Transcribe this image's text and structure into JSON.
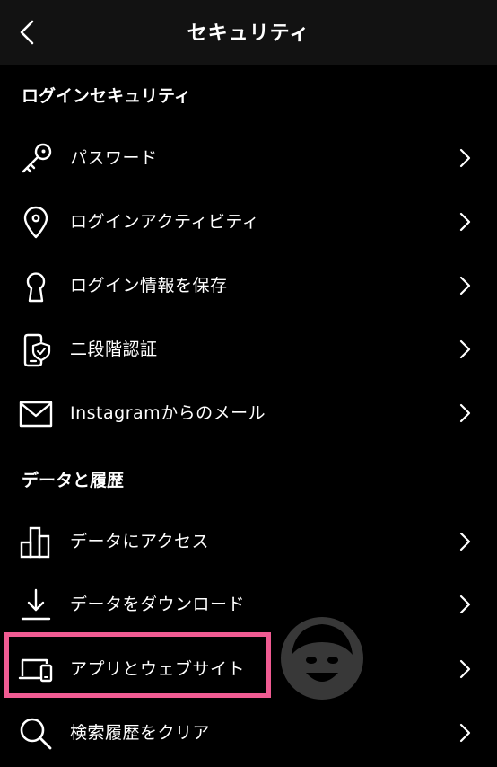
{
  "header": {
    "title": "セキュリティ",
    "back_icon": "chevron-left-icon"
  },
  "sections": [
    {
      "title": "ログインセキュリティ",
      "items": [
        {
          "label": "パスワード",
          "icon": "key-icon"
        },
        {
          "label": "ログインアクティビティ",
          "icon": "location-pin-icon"
        },
        {
          "label": "ログイン情報を保存",
          "icon": "keyhole-icon"
        },
        {
          "label": "二段階認証",
          "icon": "phone-shield-icon"
        },
        {
          "label": "Instagramからのメール",
          "icon": "mail-icon"
        }
      ]
    },
    {
      "title": "データと履歴",
      "items": [
        {
          "label": "データにアクセス",
          "icon": "bar-chart-icon"
        },
        {
          "label": "データをダウンロード",
          "icon": "download-icon"
        },
        {
          "label": "アプリとウェブサイト",
          "icon": "devices-icon"
        },
        {
          "label": "検索履歴をクリア",
          "icon": "search-icon"
        }
      ]
    }
  ],
  "colors": {
    "background": "#000000",
    "header_background": "#121212",
    "text": "#ffffff",
    "highlight": "#ef5b92"
  }
}
